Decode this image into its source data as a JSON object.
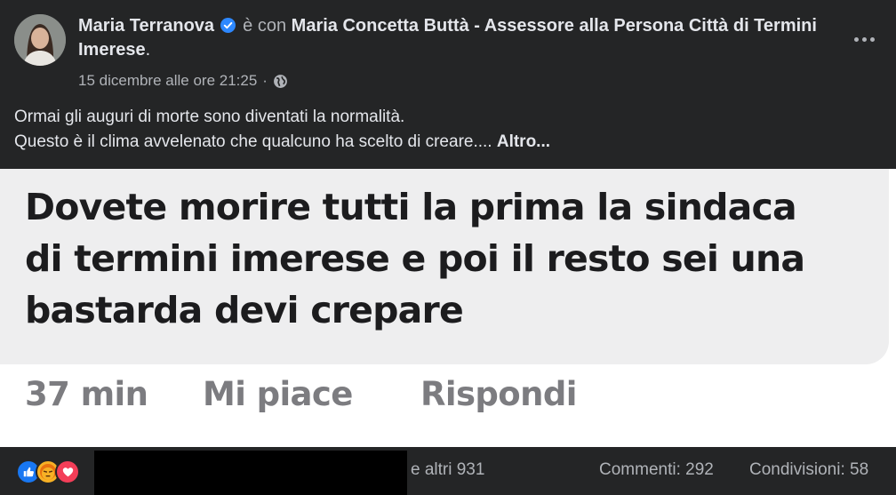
{
  "post": {
    "author": "Maria Terranova",
    "with_text": "è con",
    "tagged": "Maria Concetta Buttà - Assessore alla Persona Città di Termini Imerese",
    "tagged_end": ".",
    "timestamp": "15 dicembre alle ore 21:25",
    "separator": "·",
    "text_line1": "Ormai gli auguri di morte sono diventati la normalità.",
    "text_line2": "Questo è il clima avvelenato che qualcuno ha scelto di creare....",
    "more_link": "Altro..."
  },
  "image": {
    "comment_lines": [
      "Dovete morire tutti la prima la sindaca",
      "di termini imerese e poi il resto sei una",
      "bastarda devi crepare"
    ],
    "time": "37 min",
    "like": "Mi piace",
    "reply": "Rispondi"
  },
  "footer": {
    "reactions": [
      "like-icon",
      "angry-icon",
      "love-icon"
    ],
    "others": "e altri 931",
    "comments": "Commenti: 292",
    "shares": "Condivisioni: 58"
  },
  "colors": {
    "background": "#242526",
    "text": "#e4e6eb",
    "muted": "#b0b3b8",
    "verified": "#2d88ff",
    "like": "#1877f2",
    "angry": "#f7b125",
    "love": "#f33e58"
  }
}
